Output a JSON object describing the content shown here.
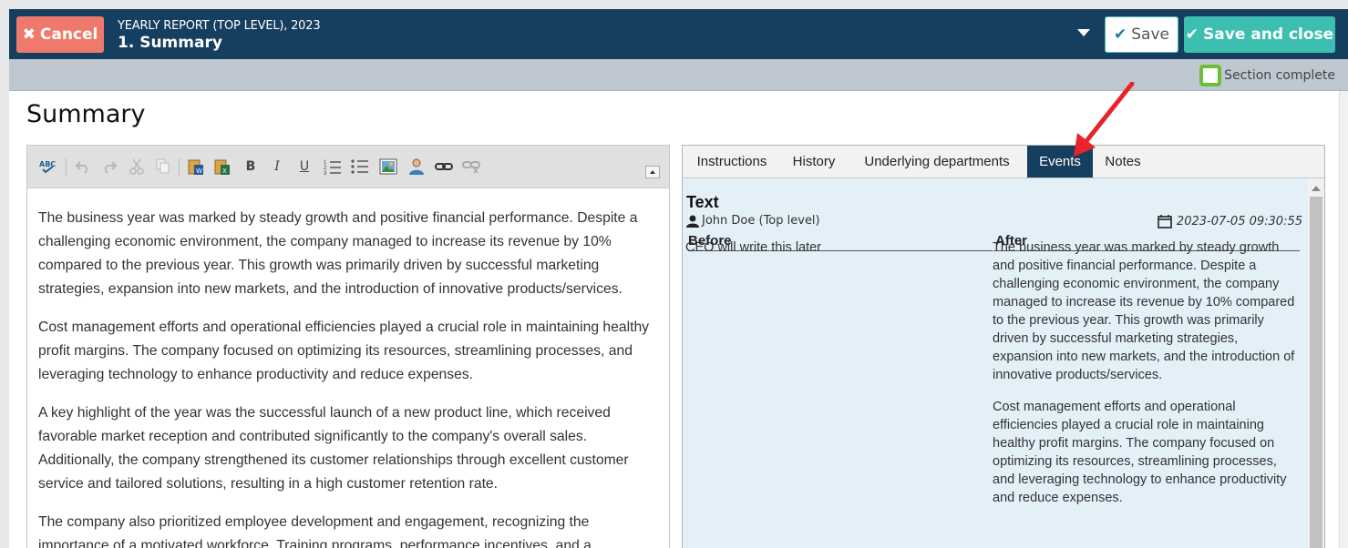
{
  "header": {
    "cancel_label": "Cancel",
    "report_title": "YEARLY REPORT (TOP LEVEL), 2023",
    "section_title": "1. Summary",
    "save_label": "Save",
    "save_close_label": "Save and close"
  },
  "status": {
    "section_complete_label": "Section complete"
  },
  "page": {
    "title": "Summary"
  },
  "editor": {
    "toolbar_icons": [
      "spellcheck-icon",
      "undo-icon",
      "redo-icon",
      "cut-icon",
      "copy-icon",
      "paste-word-icon",
      "paste-excel-icon",
      "bold-icon",
      "italic-icon",
      "underline-icon",
      "numbered-list-icon",
      "bulleted-list-icon",
      "image-icon",
      "user-mention-icon",
      "link-icon",
      "unlink-icon"
    ],
    "paragraphs": [
      "The business year was marked by steady growth and positive financial performance. Despite a challenging economic environment, the company managed to increase its revenue by 10% compared to the previous year. This growth was primarily driven by successful marketing strategies, expansion into new markets, and the introduction of innovative products/services.",
      "Cost management efforts and operational efficiencies played a crucial role in maintaining healthy profit margins. The company focused on optimizing its resources, streamlining processes, and leveraging technology to enhance productivity and reduce expenses.",
      "A key highlight of the year was the successful launch of a new product line, which received favorable market reception and contributed significantly to the company's overall sales. Additionally, the company strengthened its customer relationships through excellent customer service and tailored solutions, resulting in a high customer retention rate.",
      "The company also prioritized employee development and engagement, recognizing the importance of a motivated workforce. Training programs, performance incentives, and a"
    ]
  },
  "tabs": [
    {
      "label": "Instructions",
      "active": false
    },
    {
      "label": "History",
      "active": false
    },
    {
      "label": "Underlying departments",
      "active": false
    },
    {
      "label": "Events",
      "active": true
    },
    {
      "label": "Notes",
      "active": false
    }
  ],
  "event": {
    "field": "Text",
    "user": "John Doe (Top level)",
    "timestamp": "2023-07-05 09:30:55",
    "before_header": "Before",
    "after_header": "After",
    "before_text": "CEO will write this later",
    "after_paragraphs": [
      "The business year was marked by steady growth and positive financial performance. Despite a challenging economic environment, the company managed to increase its revenue by 10% compared to the previous year. This growth was primarily driven by successful marketing strategies, expansion into new markets, and the introduction of innovative products/services.",
      "Cost management efforts and operational efficiencies played a crucial role in maintaining healthy profit margins. The company focused on optimizing its resources, streamlining processes, and leveraging technology to enhance productivity and reduce expenses."
    ]
  },
  "colors": {
    "header_bg": "#163e5f",
    "cancel_bg": "#ef7a6b",
    "save_close_bg": "#3cbfb0",
    "checkbox_border": "#6abf3a",
    "panel_bg": "#e4f0f8",
    "arrow": "#e8232b"
  }
}
